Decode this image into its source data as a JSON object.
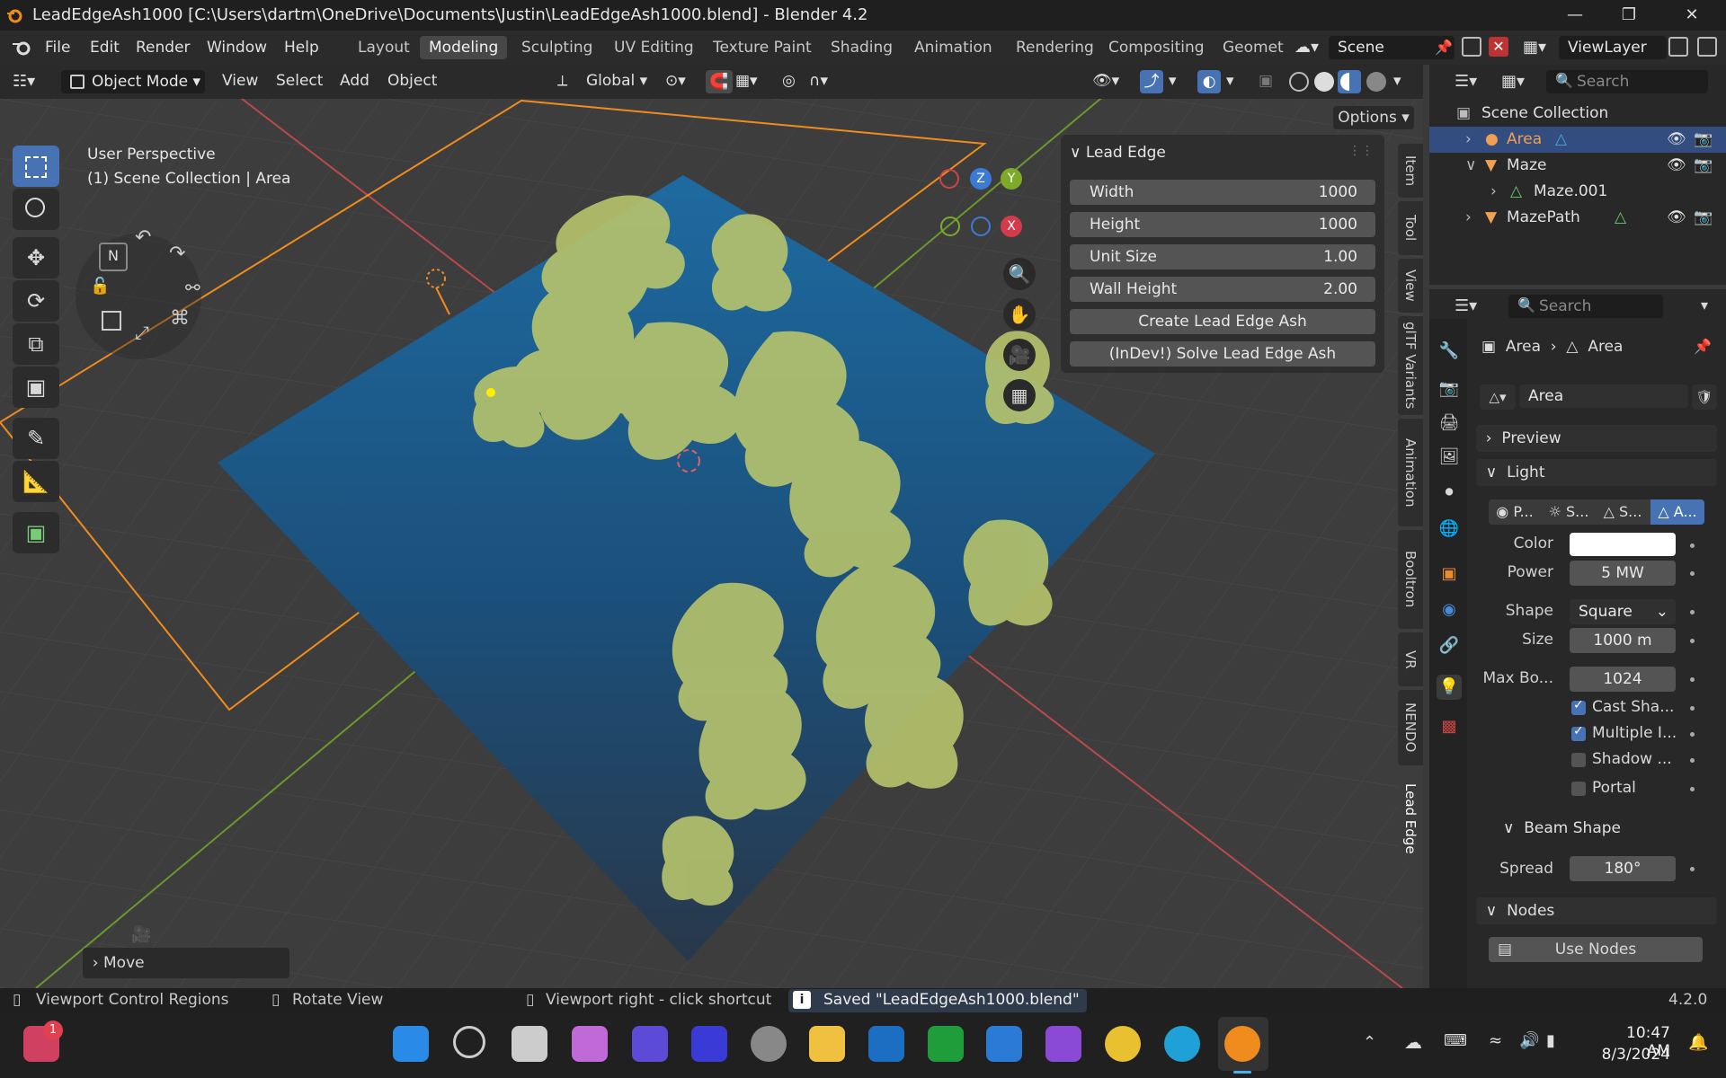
{
  "window": {
    "title": "LeadEdgeAsh1000 [C:\\Users\\dartm\\OneDrive\\Documents\\Justin\\LeadEdgeAsh1000.blend] - Blender 4.2"
  },
  "menu": [
    "File",
    "Edit",
    "Render",
    "Window",
    "Help"
  ],
  "workspaces": [
    "Layout",
    "Modeling",
    "Sculpting",
    "UV Editing",
    "Texture Paint",
    "Shading",
    "Animation",
    "Rendering",
    "Compositing",
    "Geomet"
  ],
  "active_workspace": "Modeling",
  "scene": "Scene",
  "view_layer": "ViewLayer",
  "viewport_header": {
    "mode": "Object Mode",
    "menus": [
      "View",
      "Select",
      "Add",
      "Object"
    ],
    "orientation": "Global",
    "options": "Options"
  },
  "viewport": {
    "perspective": "User Perspective",
    "collection": "(1) Scene Collection | Area",
    "last_op": "Move",
    "gizmo": {
      "z": "Z",
      "y": "Y",
      "x": "X"
    }
  },
  "sidebar_tabs": [
    "Item",
    "Tool",
    "View",
    "glTF Variants",
    "Animation",
    "Booltron",
    "VR",
    "NENDO",
    "Lead Edge"
  ],
  "lead_edge_panel": {
    "title": "Lead Edge",
    "fields": [
      {
        "label": "Width",
        "value": "1000"
      },
      {
        "label": "Height",
        "value": "1000"
      },
      {
        "label": "Unit Size",
        "value": "1.00"
      },
      {
        "label": "Wall Height",
        "value": "2.00"
      }
    ],
    "create_button": "Create Lead Edge Ash",
    "solve_button": "(InDev!) Solve Lead Edge Ash"
  },
  "outliner": {
    "search_placeholder": "Search",
    "root": "Scene Collection",
    "items": [
      "Area",
      "Maze",
      "Maze.001",
      "MazePath"
    ]
  },
  "properties": {
    "search_placeholder": "Search",
    "breadcrumb": [
      "Area",
      "Area"
    ],
    "datablock": "Area",
    "sections": {
      "preview": "Preview",
      "light": "Light",
      "beam_shape": "Beam Shape",
      "nodes": "Nodes"
    },
    "light_types": [
      "P...",
      "S...",
      "S...",
      "A..."
    ],
    "color_label": "Color",
    "power_label": "Power",
    "power": "5 MW",
    "shape_label": "Shape",
    "shape": "Square",
    "size_label": "Size",
    "size": "1000 m",
    "max_bounces_label": "Max Bo...",
    "max_bounces": "1024",
    "checkboxes": [
      {
        "label": "Cast Sha...",
        "checked": true
      },
      {
        "label": "Multiple I...",
        "checked": true
      },
      {
        "label": "Shadow ...",
        "checked": false
      },
      {
        "label": "Portal",
        "checked": false
      }
    ],
    "spread_label": "Spread",
    "spread": "180°",
    "use_nodes": "Use Nodes"
  },
  "status": {
    "left": "Viewport Control Regions",
    "mid": "Rotate View",
    "right": "Viewport right - click shortcut",
    "message": "Saved \"LeadEdgeAsh1000.blend\"",
    "version": "4.2.0"
  },
  "taskbar": {
    "time": "10:47 AM",
    "date": "8/3/2024",
    "badge": "1"
  },
  "colors": {
    "accent": "#4772b3",
    "outline_orange": "#f08c1e",
    "plane_blue": "#1e5a8a",
    "maze_green": "#b4c46a"
  }
}
